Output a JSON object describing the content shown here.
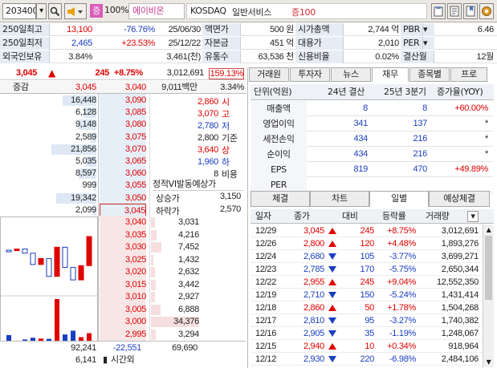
{
  "toolbar": {
    "code": "203400",
    "badge": "증",
    "margin": "100%",
    "name": "에이비온",
    "market": "KOSDAQ",
    "sector": "일반서비스",
    "sector_badge": "증100"
  },
  "info": {
    "r1": {
      "l1": "250일최고",
      "v1": "13,100",
      "p1": "-76.76%",
      "d1": "25/06/30",
      "l2": "액면가",
      "v2": "500 원",
      "l3": "시가총액",
      "v3": "2,744 억",
      "l4": "PBR",
      "v4": "6.46"
    },
    "r2": {
      "l1": "250일최저",
      "v1": "2,465",
      "p1": "+23.53%",
      "d1": "25/12/22",
      "l2": "자본금",
      "v2": "451 억",
      "l3": "대용가",
      "v3": "2,010",
      "l4": "PER",
      "v4": ""
    },
    "r3": {
      "l1": "외국인보유",
      "v1": "3.84%",
      "v1b": "3,461(천)",
      "l2": "유통수",
      "v2": "63,536 천",
      "l3": "신용비율",
      "v3": "0.02%",
      "l4": "결산월",
      "v4": "12월"
    }
  },
  "price": {
    "current": "3,045",
    "change": "245",
    "rate": "+8.75%",
    "volume": "3,012,691",
    "vol_rate": "159.13%"
  },
  "orderbook": {
    "header": {
      "label": "증감",
      "ask_top": "3,045",
      "price_top": "3,040",
      "value": "9,011백만",
      "pct": "3.34%"
    },
    "asks": [
      {
        "qty": "16,448",
        "price": "3,090"
      },
      {
        "qty": "6,128",
        "price": "3,085"
      },
      {
        "qty": "9,148",
        "price": "3,080"
      },
      {
        "qty": "2,589",
        "price": "3,075"
      },
      {
        "qty": "21,856",
        "price": "3,070"
      },
      {
        "qty": "5,035",
        "price": "3,065"
      },
      {
        "qty": "8,597",
        "price": "3,060"
      },
      {
        "qty": "999",
        "price": "3,055"
      },
      {
        "qty": "19,342",
        "price": "3,050"
      },
      {
        "qty": "2,099",
        "price": "3,045"
      }
    ],
    "stats": [
      {
        "val": "2,860",
        "lbl": "시"
      },
      {
        "val": "3,070",
        "lbl": "고"
      },
      {
        "val": "2,780",
        "lbl": "저"
      },
      {
        "val": "2,800",
        "lbl": "기준"
      },
      {
        "val": "3,640",
        "lbl": "상"
      },
      {
        "val": "1,960",
        "lbl": "하"
      },
      {
        "val": "8",
        "lbl": "비용"
      }
    ],
    "vi": {
      "title": "정적VI발동예상가",
      "up_lbl": "상승가",
      "up": "3,150",
      "dn_lbl": "하락가",
      "dn": "2,570"
    },
    "bids": [
      {
        "price": "3,040",
        "qty": "3,031"
      },
      {
        "price": "3,035",
        "qty": "4,216"
      },
      {
        "price": "3,030",
        "qty": "7,452"
      },
      {
        "price": "3,025",
        "qty": "1,432"
      },
      {
        "price": "3,020",
        "qty": "2,632"
      },
      {
        "price": "3,015",
        "qty": "3,442"
      },
      {
        "price": "3,010",
        "qty": "2,927"
      },
      {
        "price": "3,005",
        "qty": "6,888"
      },
      {
        "price": "3,000",
        "qty": "34,376"
      },
      {
        "price": "2,995",
        "qty": "3,294"
      }
    ],
    "footer": {
      "ask_total": "92,241",
      "net": "-22,551",
      "bid_total": "69,690",
      "time_qty": "6,141",
      "time_lbl": "시간외"
    }
  },
  "tabs_top": [
    "거래원",
    "투자자",
    "뉴스",
    "재무",
    "종목별",
    "프로"
  ],
  "finance": {
    "headers": [
      "단위(억원)",
      "24년 결산",
      "25년 3분기",
      "증가율(YOY)"
    ],
    "rows": [
      {
        "name": "매출액",
        "a": "8",
        "b": "8",
        "c": "+60.00%"
      },
      {
        "name": "영업이익",
        "a": "341",
        "b": "137",
        "c": "*"
      },
      {
        "name": "세전손익",
        "a": "434",
        "b": "216",
        "c": "*"
      },
      {
        "name": "순이익",
        "a": "434",
        "b": "216",
        "c": "*"
      },
      {
        "name": "EPS",
        "a": "819",
        "b": "470",
        "c": "+49.89%"
      },
      {
        "name": "PER",
        "a": "",
        "b": "",
        "c": ""
      }
    ]
  },
  "tabs_bottom": [
    "체결",
    "차트",
    "일별",
    "예상체결"
  ],
  "daily": {
    "headers": [
      "일자",
      "종가",
      "대비",
      "등락률",
      "거래량"
    ],
    "rows": [
      {
        "date": "12/29",
        "close": "3,045",
        "dir": "up",
        "chg": "245",
        "rate": "+8.75%",
        "vol": "3,012,691"
      },
      {
        "date": "12/26",
        "close": "2,800",
        "dir": "up",
        "chg": "120",
        "rate": "+4.48%",
        "vol": "1,893,276"
      },
      {
        "date": "12/24",
        "close": "2,680",
        "dir": "down",
        "chg": "105",
        "rate": "-3.77%",
        "vol": "3,699,271"
      },
      {
        "date": "12/23",
        "close": "2,785",
        "dir": "down",
        "chg": "170",
        "rate": "-5.75%",
        "vol": "2,650,344"
      },
      {
        "date": "12/22",
        "close": "2,955",
        "dir": "up",
        "chg": "245",
        "rate": "+9.04%",
        "vol": "12,552,350"
      },
      {
        "date": "12/19",
        "close": "2,710",
        "dir": "down",
        "chg": "150",
        "rate": "-5.24%",
        "vol": "1,431,414"
      },
      {
        "date": "12/18",
        "close": "2,860",
        "dir": "up",
        "chg": "50",
        "rate": "+1.78%",
        "vol": "1,504,268"
      },
      {
        "date": "12/17",
        "close": "2,810",
        "dir": "down",
        "chg": "95",
        "rate": "-3.27%",
        "vol": "1,740,382"
      },
      {
        "date": "12/16",
        "close": "2,905",
        "dir": "down",
        "chg": "35",
        "rate": "-1.19%",
        "vol": "1,248,067"
      },
      {
        "date": "12/15",
        "close": "2,940",
        "dir": "up",
        "chg": "10",
        "rate": "+0.34%",
        "vol": "918,964"
      },
      {
        "date": "12/12",
        "close": "2,930",
        "dir": "down",
        "chg": "220",
        "rate": "-6.98%",
        "vol": "2,484,106"
      }
    ]
  },
  "colors": {
    "up": "#e00000",
    "down": "#1a3ec0",
    "label_bg": "#e6ecf3",
    "ask_bar": "#dde8f4",
    "bid_bar": "#f6dede"
  }
}
